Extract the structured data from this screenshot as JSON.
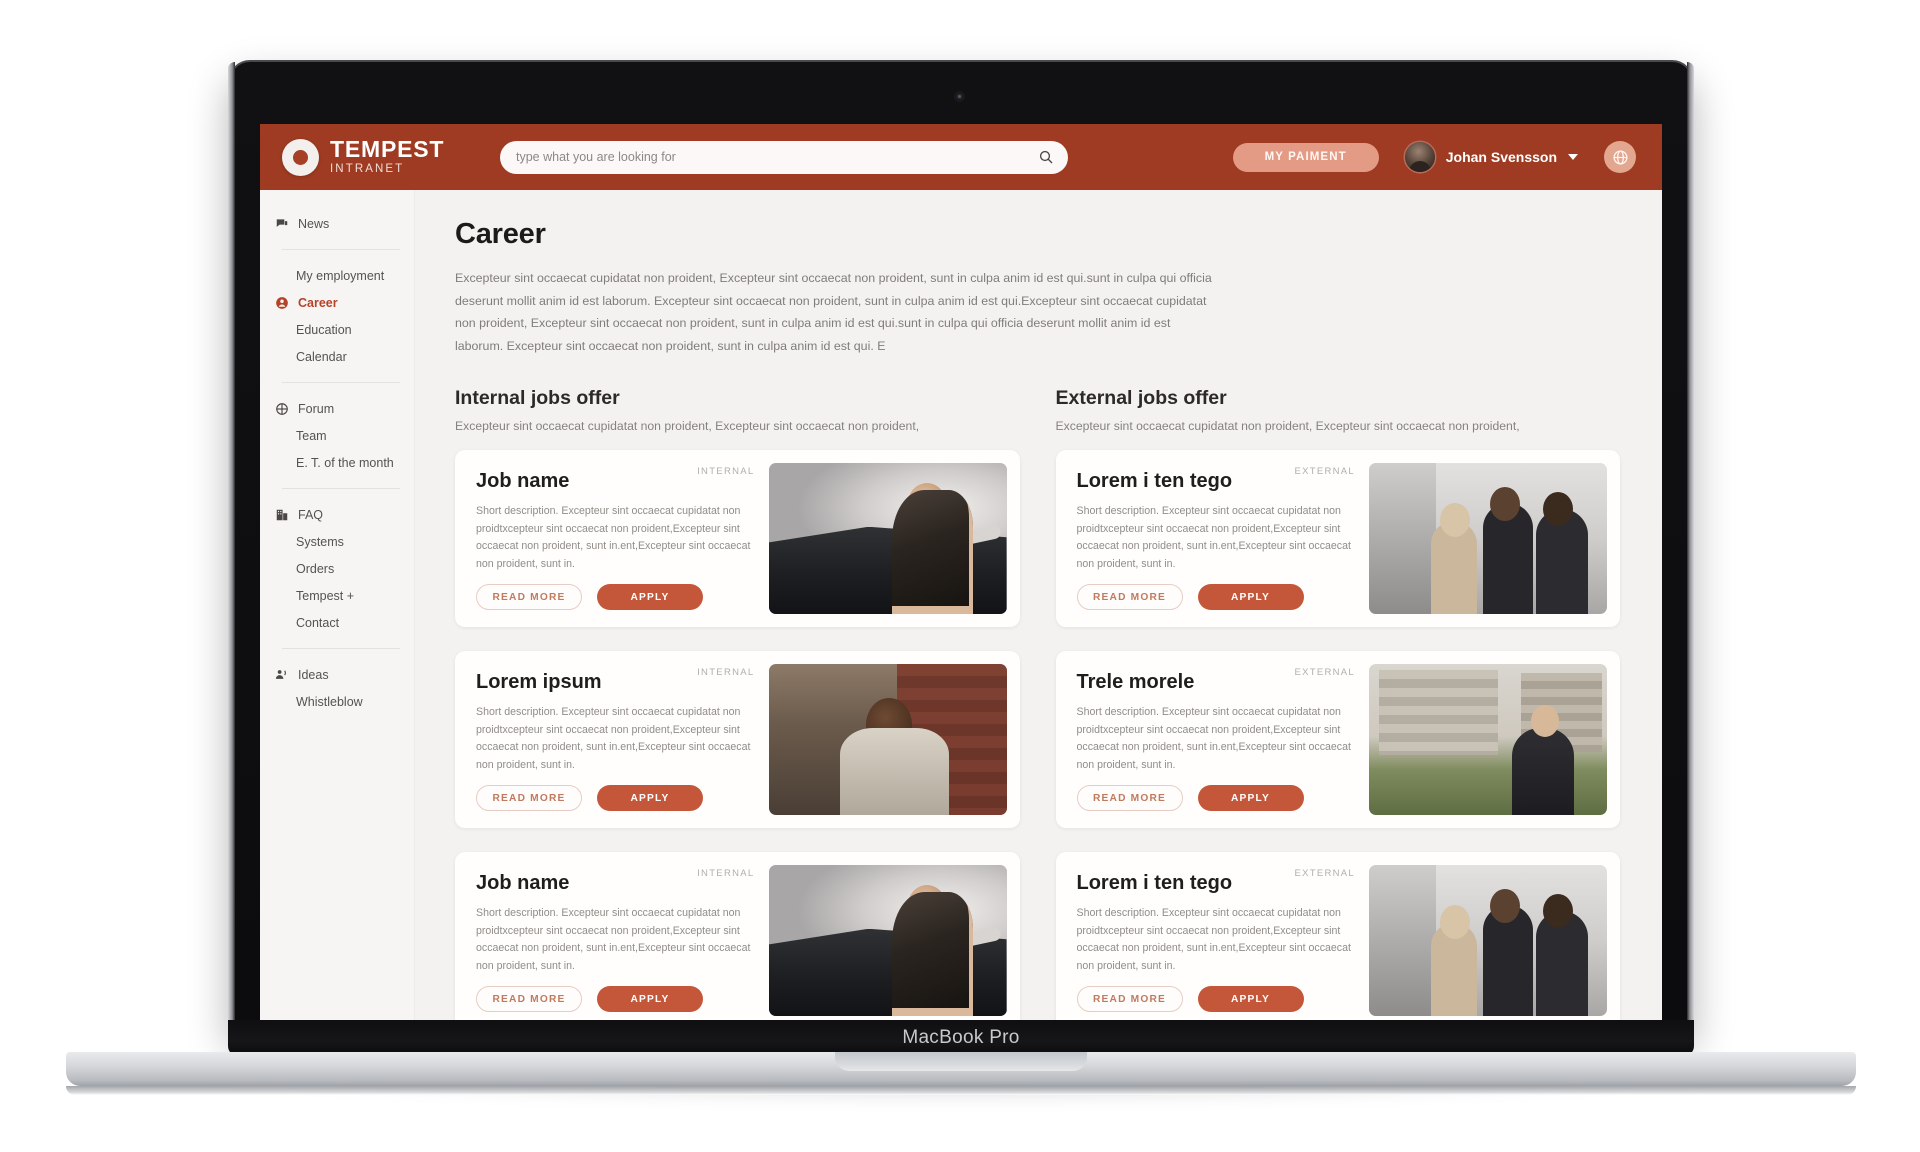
{
  "device": {
    "label": "MacBook Pro"
  },
  "header": {
    "brand": {
      "name": "TEMPEST",
      "sub": "INTRANET",
      "logo_icon": "tempest-ring-logo"
    },
    "search": {
      "placeholder": "type what you are looking for",
      "value": "",
      "icon": "search-icon"
    },
    "payment_button": "MY PAIMENT",
    "user": {
      "name": "Johan Svensson",
      "chevron_icon": "chevron-down-icon",
      "avatar_icon": "user-avatar"
    },
    "language_icon": "globe-icon",
    "accent_color": "#9e3b22"
  },
  "sidebar": {
    "groups": [
      {
        "items": [
          {
            "label": "News",
            "icon": "news-icon",
            "active": false,
            "sub": false
          }
        ]
      },
      {
        "items": [
          {
            "label": "My employment",
            "icon": "",
            "active": false,
            "sub": true
          },
          {
            "label": "Career",
            "icon": "person-circle-icon",
            "active": true,
            "sub": false
          },
          {
            "label": "Education",
            "icon": "",
            "active": false,
            "sub": true
          },
          {
            "label": "Calendar",
            "icon": "",
            "active": false,
            "sub": true
          }
        ]
      },
      {
        "items": [
          {
            "label": "Forum",
            "icon": "forum-globe-icon",
            "active": false,
            "sub": false
          },
          {
            "label": "Team",
            "icon": "",
            "active": false,
            "sub": true
          },
          {
            "label": "E. T. of the month",
            "icon": "",
            "active": false,
            "sub": true
          }
        ]
      },
      {
        "items": [
          {
            "label": "FAQ",
            "icon": "building-icon",
            "active": false,
            "sub": false
          },
          {
            "label": "Systems",
            "icon": "",
            "active": false,
            "sub": true
          },
          {
            "label": "Orders",
            "icon": "",
            "active": false,
            "sub": true
          },
          {
            "label": "Tempest +",
            "icon": "",
            "active": false,
            "sub": true
          },
          {
            "label": "Contact",
            "icon": "",
            "active": false,
            "sub": true
          }
        ]
      },
      {
        "items": [
          {
            "label": "Ideas",
            "icon": "announcement-icon",
            "active": false,
            "sub": false
          },
          {
            "label": "Whistleblow",
            "icon": "",
            "active": false,
            "sub": true
          }
        ]
      }
    ]
  },
  "main": {
    "title": "Career",
    "intro": "Excepteur sint occaecat cupidatat non proident, Excepteur sint occaecat non proident, sunt in culpa anim id est qui.sunt in culpa qui officia deserunt mollit anim id est laborum. Excepteur sint occaecat non proident, sunt in culpa anim id est qui.Excepteur sint occaecat cupidatat non proident, Excepteur sint occaecat non proident, sunt in culpa anim id est qui.sunt in culpa qui officia deserunt mollit anim id est laborum. Excepteur sint occaecat non proident, sunt in culpa anim id est qui. E",
    "columns": [
      {
        "heading": "Internal jobs offer",
        "sub": "Excepteur sint occaecat cupidatat non proident, Excepteur sint occaecat non proident,",
        "cards": [
          {
            "tag": "INTERNAL",
            "title": "Job name",
            "desc": "Short description. Excepteur sint occaecat cupidatat non proidtxcepteur sint occaecat non proident,Excepteur sint occaecat non proident, sunt in.ent,Excepteur sint occaecat non proident, sunt in.",
            "read_more": "READ MORE",
            "apply": "APPLY",
            "photo": "ph-car"
          },
          {
            "tag": "INTERNAL",
            "title": "Lorem ipsum",
            "desc": "Short description. Excepteur sint occaecat cupidatat non proidtxcepteur sint occaecat non proident,Excepteur sint occaecat non proident, sunt in.ent,Excepteur sint occaecat non proident, sunt in.",
            "read_more": "READ MORE",
            "apply": "APPLY",
            "photo": "ph-fire"
          },
          {
            "tag": "INTERNAL",
            "title": "Job name",
            "desc": "Short description. Excepteur sint occaecat cupidatat non proidtxcepteur sint occaecat non proident,Excepteur sint occaecat non proident, sunt in.ent,Excepteur sint occaecat non proident, sunt in.",
            "read_more": "READ MORE",
            "apply": "APPLY",
            "photo": "ph-car"
          }
        ]
      },
      {
        "heading": "External  jobs offer",
        "sub": "Excepteur sint occaecat cupidatat non proident, Excepteur sint occaecat non proident,",
        "cards": [
          {
            "tag": "EXTERNAL",
            "title": "Lorem i  ten tego",
            "desc": "Short description. Excepteur sint occaecat cupidatat non proidtxcepteur sint occaecat non proident,Excepteur sint occaecat non proident, sunt in.ent,Excepteur sint occaecat non proident, sunt in.",
            "read_more": "READ MORE",
            "apply": "APPLY",
            "photo": "ph-office"
          },
          {
            "tag": "EXTERNAL",
            "title": "Trele morele",
            "desc": "Short description. Excepteur sint occaecat cupidatat non proidtxcepteur sint occaecat non proident,Excepteur sint occaecat non proident, sunt in.ent,Excepteur sint occaecat non proident, sunt in.",
            "read_more": "READ MORE",
            "apply": "APPLY",
            "photo": "ph-street"
          },
          {
            "tag": "EXTERNAL",
            "title": "Lorem i  ten tego",
            "desc": "Short description. Excepteur sint occaecat cupidatat non proidtxcepteur sint occaecat non proident,Excepteur sint occaecat non proident, sunt in.ent,Excepteur sint occaecat non proident, sunt in.",
            "read_more": "READ MORE",
            "apply": "APPLY",
            "photo": "ph-office"
          }
        ]
      }
    ]
  },
  "colors": {
    "brand": "#9e3b22",
    "apply_button": "#c4573a",
    "read_more_border": "#e6cdc3",
    "active_nav": "#b5432a",
    "payment_button": "#e39b85"
  }
}
